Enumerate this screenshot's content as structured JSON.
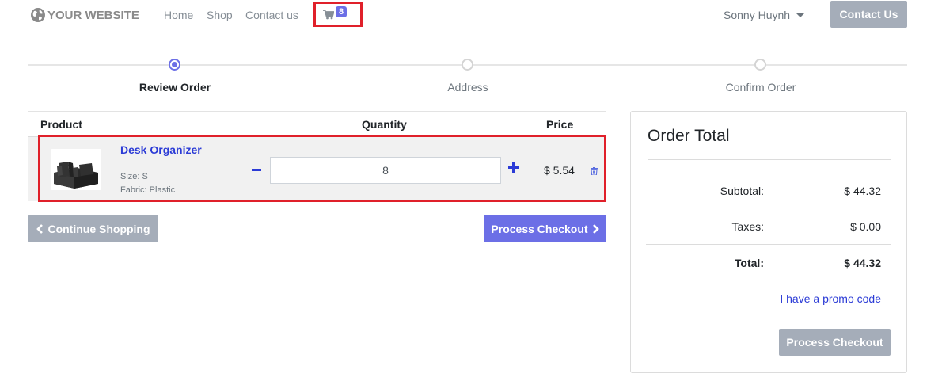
{
  "navbar": {
    "brand": "YOUR WEBSITE",
    "links": [
      "Home",
      "Shop",
      "Contact us"
    ],
    "cart_count": "8",
    "user_name": "Sonny Huynh",
    "contact_button": "Contact Us",
    "accent_color": "#6c6fe6"
  },
  "stepper": {
    "steps": [
      "Review Order",
      "Address",
      "Confirm Order"
    ],
    "active_index": 0
  },
  "cart": {
    "headers": {
      "product": "Product",
      "quantity": "Quantity",
      "price": "Price"
    },
    "items": [
      {
        "name": "Desk Organizer",
        "size": "Size: S",
        "fabric": "Fabric: Plastic",
        "quantity": "8",
        "price": "$ 5.54"
      }
    ],
    "continue_button": "Continue Shopping",
    "process_button": "Process Checkout"
  },
  "summary": {
    "title": "Order Total",
    "subtotal_label": "Subtotal:",
    "subtotal_value": "$ 44.32",
    "taxes_label": "Taxes:",
    "taxes_value": "$ 0.00",
    "total_label": "Total:",
    "total_value": "$ 44.32",
    "promo_link": "I have a promo code",
    "checkout_button": "Process Checkout"
  },
  "icons": {
    "brand": "globe-icon",
    "cart": "shopping-cart-icon",
    "delete": "trash-icon",
    "back": "chevron-left-icon",
    "forward": "chevron-right-icon"
  }
}
